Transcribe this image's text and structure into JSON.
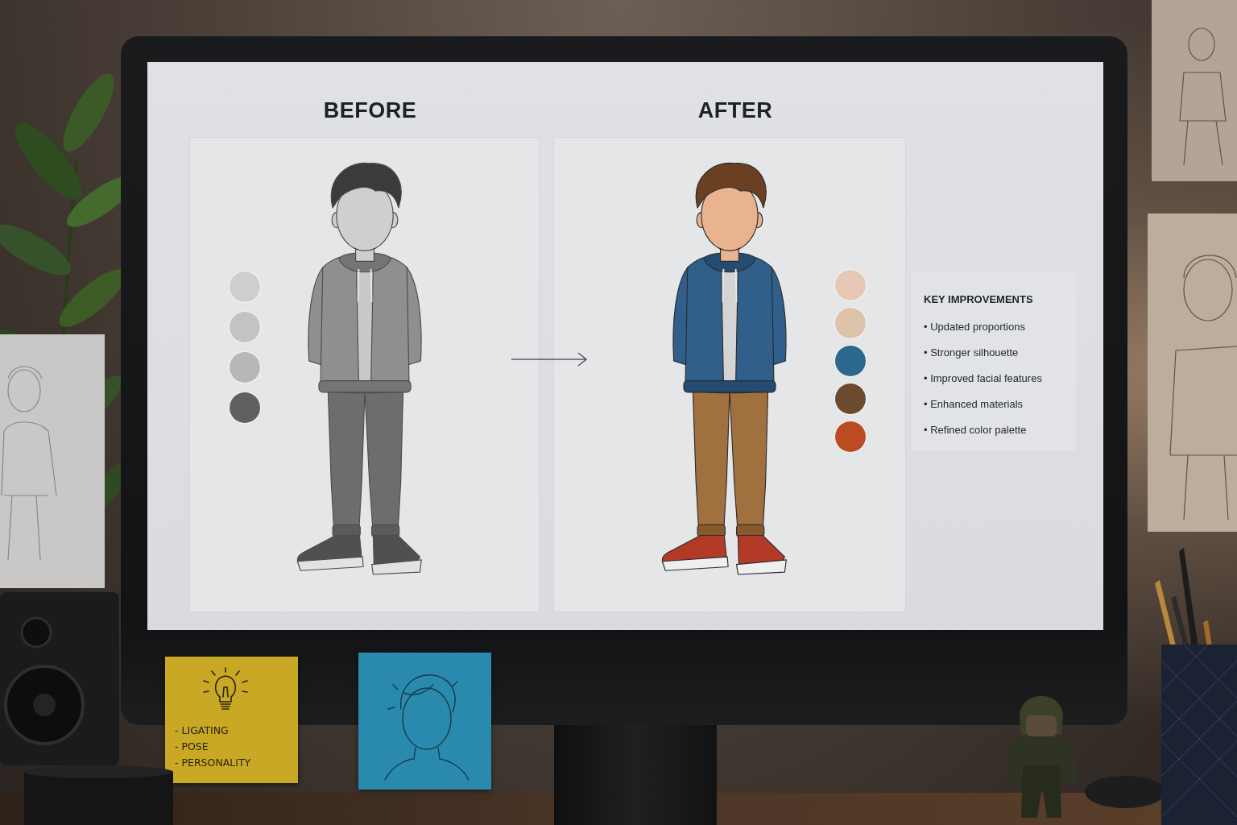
{
  "screen": {
    "panels": [
      {
        "heading": "BEFORE",
        "kind": "grayscale",
        "swatches": [
          {
            "color": "#cdcecf"
          },
          {
            "color": "#c2c3c5"
          },
          {
            "color": "#b6b7b9"
          },
          {
            "color": "#5f6061"
          }
        ]
      },
      {
        "heading": "AFTER",
        "kind": "colored",
        "swatches": [
          {
            "color": "#e5c9b4"
          },
          {
            "color": "#dcc3aa"
          },
          {
            "color": "#2c678e"
          },
          {
            "color": "#6c4a2d"
          },
          {
            "color": "#bd4b22"
          }
        ]
      }
    ],
    "key_improvements": {
      "title": "KEY IMPROVEMENTS",
      "items": [
        "• Updated proportions",
        "• Stronger silhouette",
        "• Improved facial features",
        "• Enhanced materials",
        "• Refined color palette"
      ]
    }
  },
  "sticky_notes": [
    {
      "kind": "list",
      "color": "#c9a826",
      "lines": [
        "- LIGATING",
        "- POSE",
        "- PERSONALITY"
      ]
    },
    {
      "kind": "sketch",
      "color": "#2a8aae"
    }
  ]
}
